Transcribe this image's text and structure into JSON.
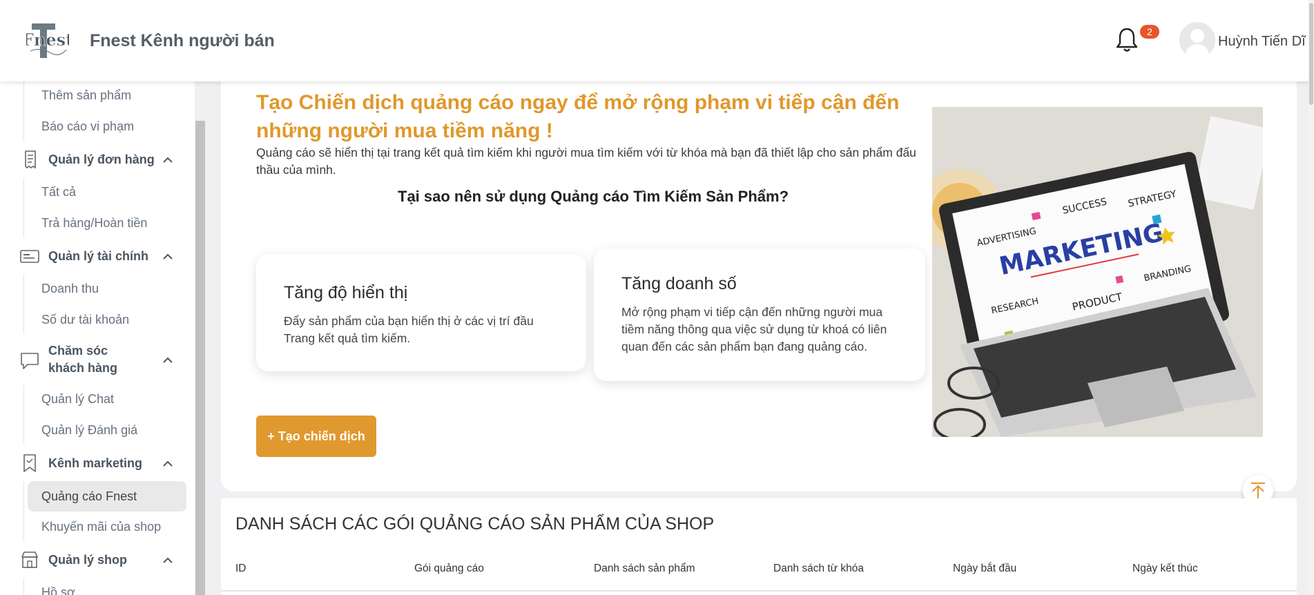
{
  "header": {
    "brand": "Fnest Kênh người bán",
    "logo_text": "Fnest",
    "notification_count": "2",
    "username": "Huỳnh Tiến Dĩ"
  },
  "sidebar": {
    "top_items": [
      "Thêm sản phẩm",
      "Báo cáo vi phạm"
    ],
    "sections": [
      {
        "title": "Quản lý đơn hàng",
        "items": [
          "Tất cả",
          "Trả hàng/Hoàn tiền"
        ]
      },
      {
        "title": "Quản lý tài chính",
        "items": [
          "Doanh thu",
          "Số dư tài khoản"
        ]
      },
      {
        "title_line1": "Chăm sóc",
        "title_line2": "khách hàng",
        "items": [
          "Quản lý Chat",
          "Quản lý Đánh giá"
        ]
      },
      {
        "title": "Kênh marketing",
        "items": [
          "Quảng cáo Fnest",
          "Khuyến mãi của shop"
        ]
      },
      {
        "title": "Quản lý shop",
        "items": [
          "Hồ sơ"
        ]
      }
    ],
    "active_item": "Quảng cáo Fnest"
  },
  "main": {
    "headline": "Tạo Chiến dịch quảng cáo ngay để mở rộng phạm vi tiếp cận đến những người mua tiềm năng !",
    "description": "Quảng cáo sẽ hiển thị tại trang kết quả tìm kiếm khi người mua tìm kiếm với từ khóa mà bạn đã thiết lập cho sản phẩm đấu thầu của mình.",
    "why_title": "Tại sao nên sử dụng Quảng cáo Tìm Kiếm Sản Phẩm?",
    "benefits": [
      {
        "title": "Tăng độ hiển thị",
        "desc": "Đẩy sản phẩm của bạn hiển thị ở các vị trí đầu Trang kết quả tìm kiếm."
      },
      {
        "title": "Tăng doanh số",
        "desc": "Mở rộng phạm vi tiếp cận đến những người mua tiềm năng thông qua việc sử dụng từ khoá có liên quan đến các sản phẩm bạn đang quảng cáo."
      }
    ],
    "create_button": "+ Tạo chiến dịch",
    "hero_words": {
      "marketing": "MARKETING",
      "advertising": "ADVERTISING",
      "success": "SUCCESS",
      "strategy": "STRATEGY",
      "research": "RESEARCH",
      "product": "PRODUCT",
      "branding": "BRANDING"
    }
  },
  "list": {
    "title": "DANH SÁCH CÁC GÓI QUẢNG CÁO SẢN PHẨM CỦA SHOP",
    "columns": [
      "ID",
      "Gói quảng cáo",
      "Danh sách sản phẩm",
      "Danh sách từ khóa",
      "Ngày bắt đầu",
      "Ngày kết thúc"
    ]
  },
  "colors": {
    "accent": "#e0992e",
    "badge": "#e8562b",
    "active_bg": "#e9e9e9"
  }
}
